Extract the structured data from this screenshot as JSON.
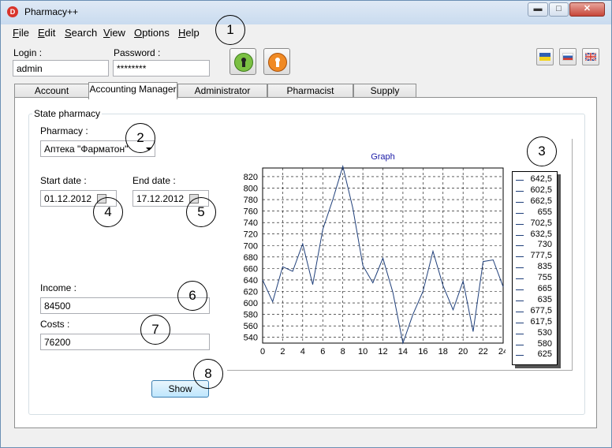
{
  "window": {
    "title": "Pharmacy++",
    "icon": "pharmacy-app-icon",
    "controls": [
      "minimize",
      "maximize",
      "close"
    ]
  },
  "menu": [
    "File",
    "Edit",
    "Search",
    "View",
    "Options",
    "Help"
  ],
  "login": {
    "login_label": "Login :",
    "login_value": "admin",
    "password_label": "Password :",
    "password_value": "********",
    "login_button_icon": "green-keyhole-icon",
    "logout_button_icon": "orange-keyhole-icon"
  },
  "flags": [
    "ukraine-flag-icon",
    "russia-flag-icon",
    "uk-flag-icon"
  ],
  "tabs": [
    "Account Manager",
    "Accounting Manager",
    "Administrator Control",
    "Pharmacist Manager",
    "Supply Manger"
  ],
  "active_tab": "Accounting Manager",
  "panel": {
    "group_title": "State pharmacy",
    "pharmacy_label": "Pharmacy :",
    "pharmacy_value": "Аптека \"Фарматон\"",
    "start_label": "Start date :",
    "start_value": "01.12.2012",
    "end_label": "End date :",
    "end_value": "17.12.2012",
    "income_label": "Income :",
    "income_value": "84500",
    "costs_label": "Costs :",
    "costs_value": "76200",
    "show_button": "Show"
  },
  "callouts": [
    "1",
    "2",
    "3",
    "4",
    "5",
    "6",
    "7",
    "8"
  ],
  "colors": {
    "line": "#1f3f7a",
    "graph_title": "#1a1aa6",
    "grid": "#000000"
  },
  "chart_data": {
    "type": "line",
    "title": "Graph",
    "xlabel": "",
    "ylabel": "",
    "x": [
      0,
      1,
      2,
      3,
      4,
      5,
      6,
      7,
      8,
      9,
      10,
      11,
      12,
      13,
      14,
      15,
      16,
      17,
      18,
      19,
      20,
      21,
      22,
      23,
      24
    ],
    "y": [
      640,
      602,
      663,
      655,
      703,
      632,
      728,
      780,
      838,
      765,
      665,
      635,
      678,
      618,
      530,
      580,
      620,
      690,
      630,
      588,
      638,
      550,
      672,
      675,
      628
    ],
    "xlim": [
      0,
      24
    ],
    "ylim": [
      530,
      835
    ],
    "xticks": [
      0,
      2,
      4,
      6,
      8,
      10,
      12,
      14,
      16,
      18,
      20,
      22,
      24
    ],
    "yticks": [
      540,
      560,
      580,
      600,
      620,
      640,
      660,
      680,
      700,
      720,
      740,
      760,
      780,
      800,
      820
    ],
    "grid": true,
    "legend_position": "right",
    "legend_values": [
      "642,5",
      "602,5",
      "662,5",
      "655",
      "702,5",
      "632,5",
      "730",
      "777,5",
      "835",
      "755",
      "665",
      "635",
      "677,5",
      "617,5",
      "530",
      "580",
      "625"
    ]
  }
}
